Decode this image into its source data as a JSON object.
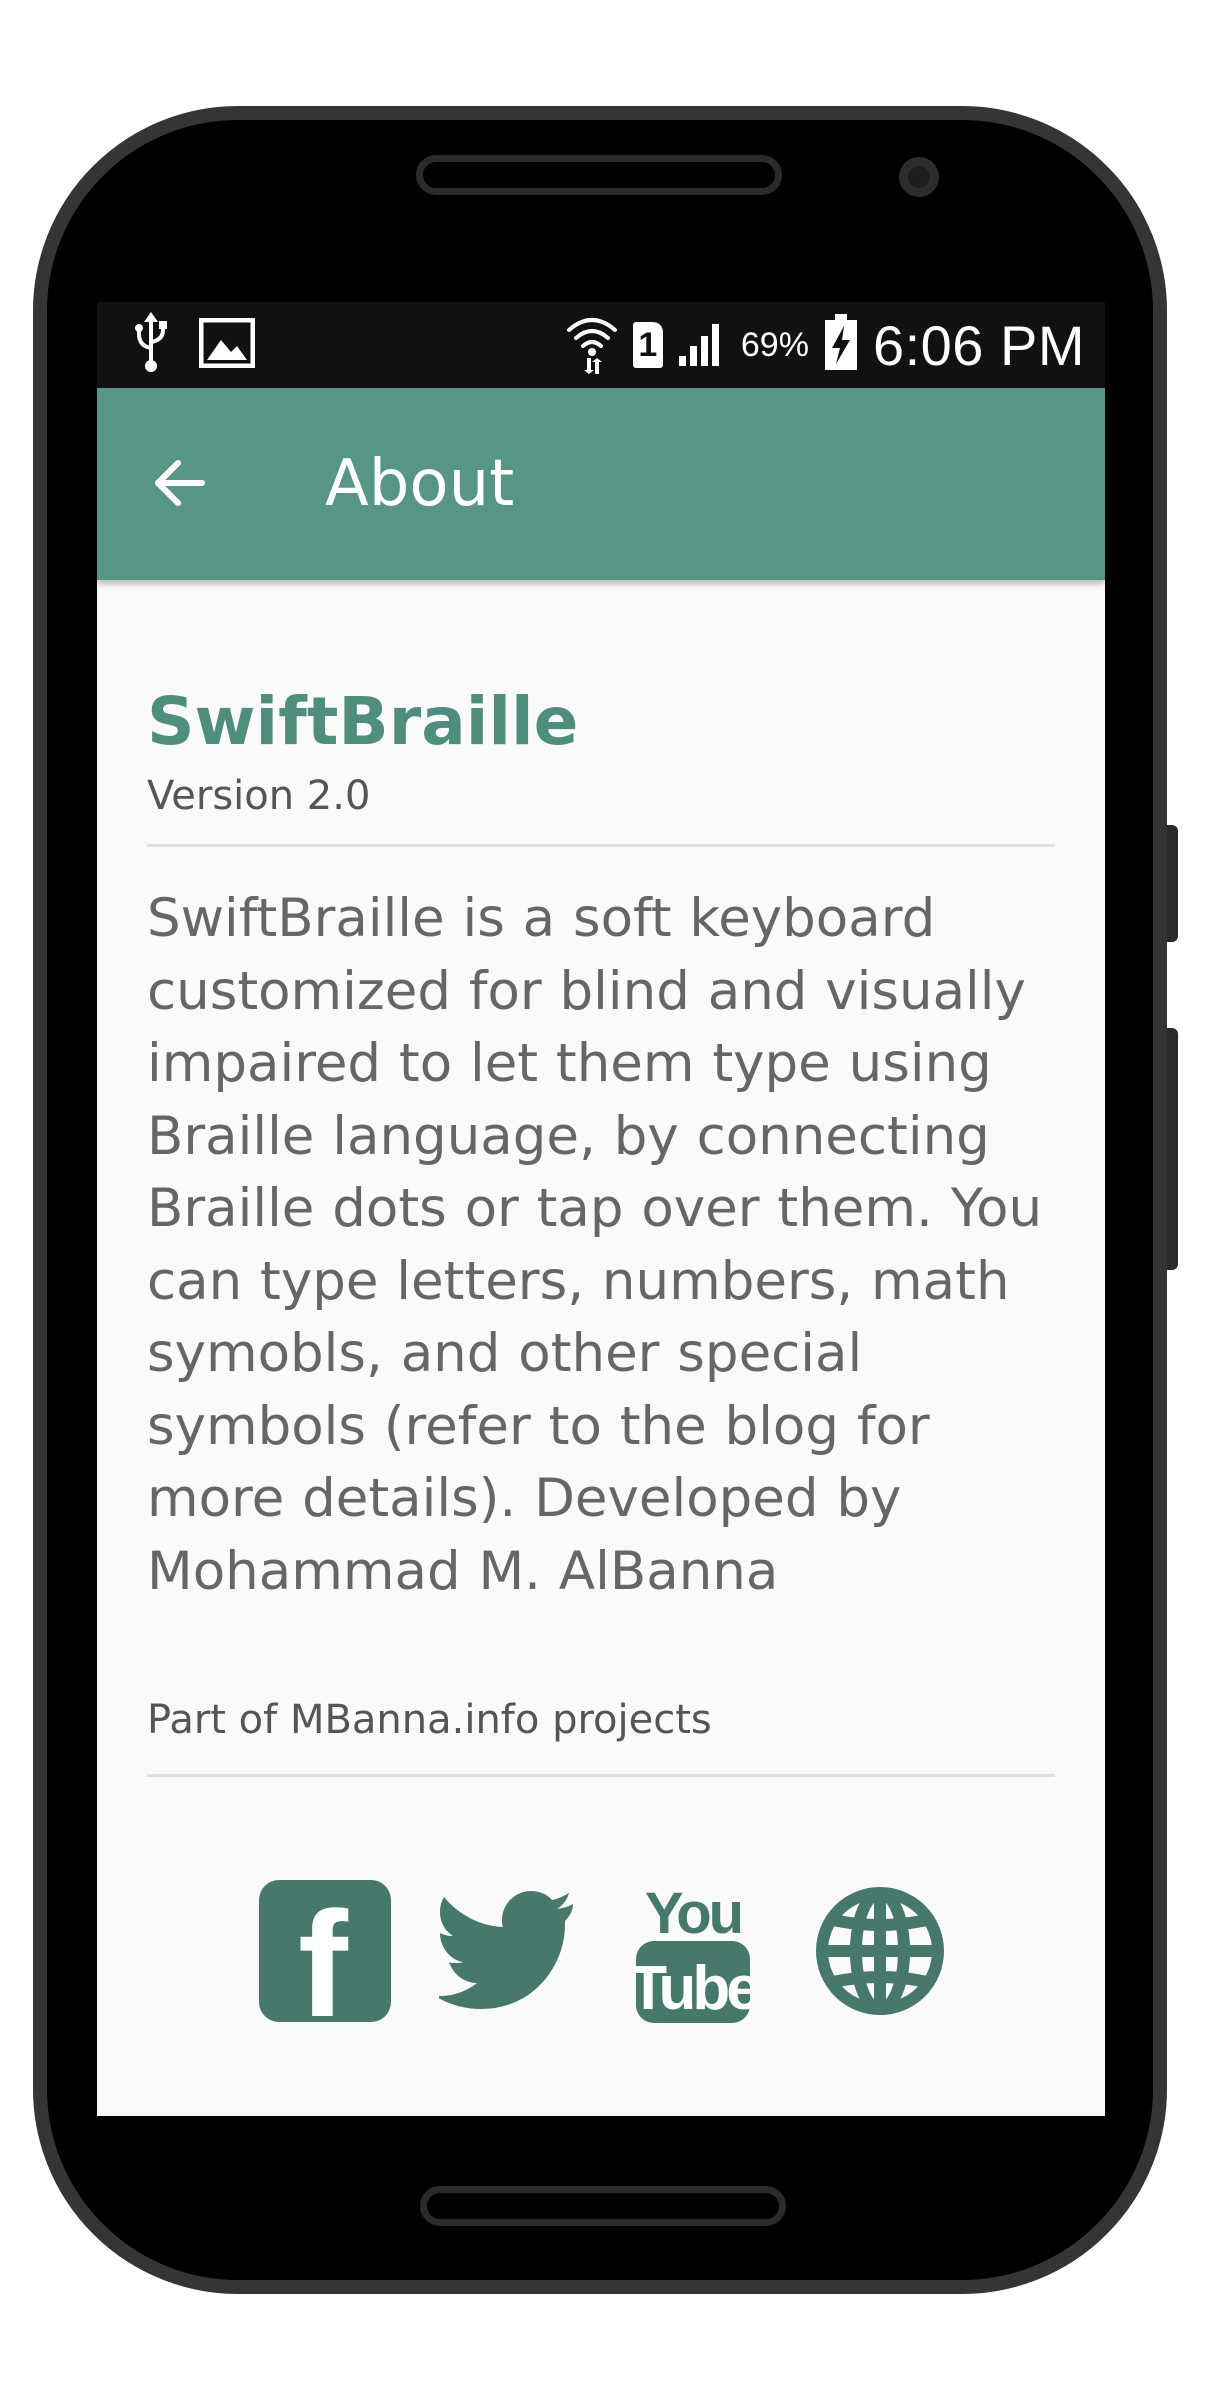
{
  "status_bar": {
    "battery_percent": "69%",
    "time": "6:06 PM",
    "sim_slot": "1",
    "icons": [
      "usb-icon",
      "image-icon",
      "wifi-icon",
      "sim-icon",
      "signal-icon",
      "battery-charging-icon"
    ]
  },
  "app_bar": {
    "title": "About",
    "back_icon": "arrow-left-icon",
    "color": "#579587"
  },
  "about": {
    "app_name": "SwiftBraille",
    "version": "Version 2.0",
    "description": "SwiftBraille is a soft keyboard customized for blind and visually impaired to let them type using Braille language, by connecting Braille dots or tap over them. You can type letters, numbers, math symobls, and other special symbols (refer to the blog for more details). Developed by Mohammad M. AlBanna",
    "projects": "Part of MBanna.info projects",
    "accent_color": "#4f8d7f"
  },
  "social_links": [
    {
      "name": "facebook",
      "icon": "facebook-icon",
      "letter": "f"
    },
    {
      "name": "twitter",
      "icon": "twitter-icon"
    },
    {
      "name": "youtube",
      "icon": "youtube-icon",
      "text_top": "You",
      "text_bottom": "Tube"
    },
    {
      "name": "website",
      "icon": "globe-icon"
    }
  ],
  "social_color": "#46786b"
}
